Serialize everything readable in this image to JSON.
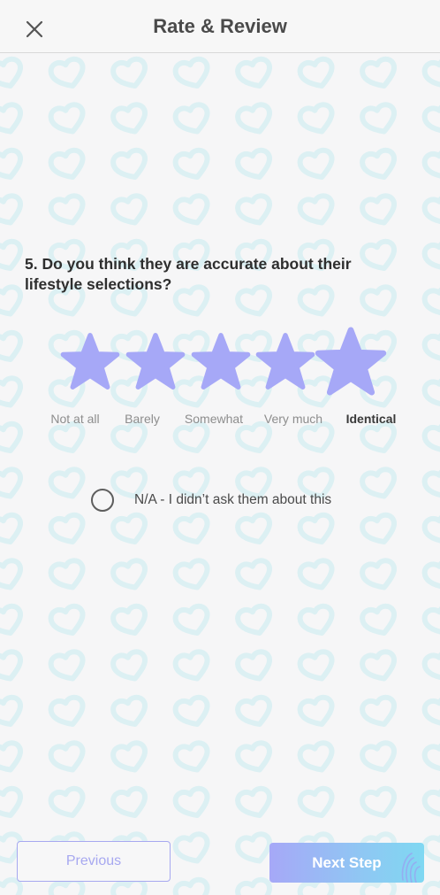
{
  "header": {
    "title": "Rate & Review",
    "close_icon": "close-icon"
  },
  "question": {
    "text": "5. Do you think they are accurate about their lifestyle selections?"
  },
  "rating": {
    "value": 5,
    "max": 5,
    "selected_index": 4,
    "star_color": "#a6a8f7",
    "labels": [
      "Not at all",
      "Barely",
      "Somewhat",
      "Very much",
      "Identical"
    ]
  },
  "na_option": {
    "label": "N/A - I didn’t ask them about this",
    "checked": false
  },
  "footer": {
    "previous_label": "Previous",
    "next_label": "Next Step"
  },
  "colors": {
    "accent": "#a6a8f7",
    "accent_secondary": "#7fd8f2",
    "background": "#f6f6f7",
    "pattern": "#dcf0f3"
  }
}
